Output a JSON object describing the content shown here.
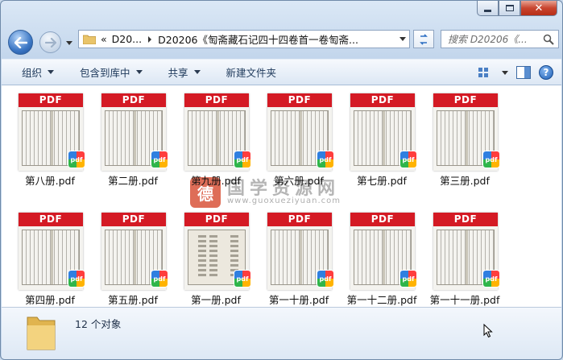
{
  "address": {
    "overflow": "«",
    "crumbs": [
      "D20...",
      "D20206《匋斋藏石记四十四卷首一卷匋斋..."
    ]
  },
  "search": {
    "placeholder": "搜索 D20206《..."
  },
  "toolbar": {
    "organize": "组织",
    "include_in_library": "包含到库中",
    "share": "共享",
    "new_folder": "新建文件夹"
  },
  "file_badge_text": "PDF",
  "files": [
    {
      "name": "第八册.pdf",
      "cover": false
    },
    {
      "name": "第二册.pdf",
      "cover": false
    },
    {
      "name": "第九册.pdf",
      "cover": false
    },
    {
      "name": "第六册.pdf",
      "cover": false
    },
    {
      "name": "第七册.pdf",
      "cover": false
    },
    {
      "name": "第三册.pdf",
      "cover": false
    },
    {
      "name": "第四册.pdf",
      "cover": false
    },
    {
      "name": "第五册.pdf",
      "cover": false
    },
    {
      "name": "第一册.pdf",
      "cover": true
    },
    {
      "name": "第一十册.pdf",
      "cover": false
    },
    {
      "name": "第一十二册.pdf",
      "cover": false
    },
    {
      "name": "第一十一册.pdf",
      "cover": false
    }
  ],
  "watermark": {
    "seal": "德",
    "title": "国学资源网",
    "url": "www.guoxueziyuan.com"
  },
  "status": {
    "count_text": "12 个对象"
  },
  "colors": {
    "pdf_red": "#d41a24",
    "window_blue": "#c3d6ec"
  }
}
